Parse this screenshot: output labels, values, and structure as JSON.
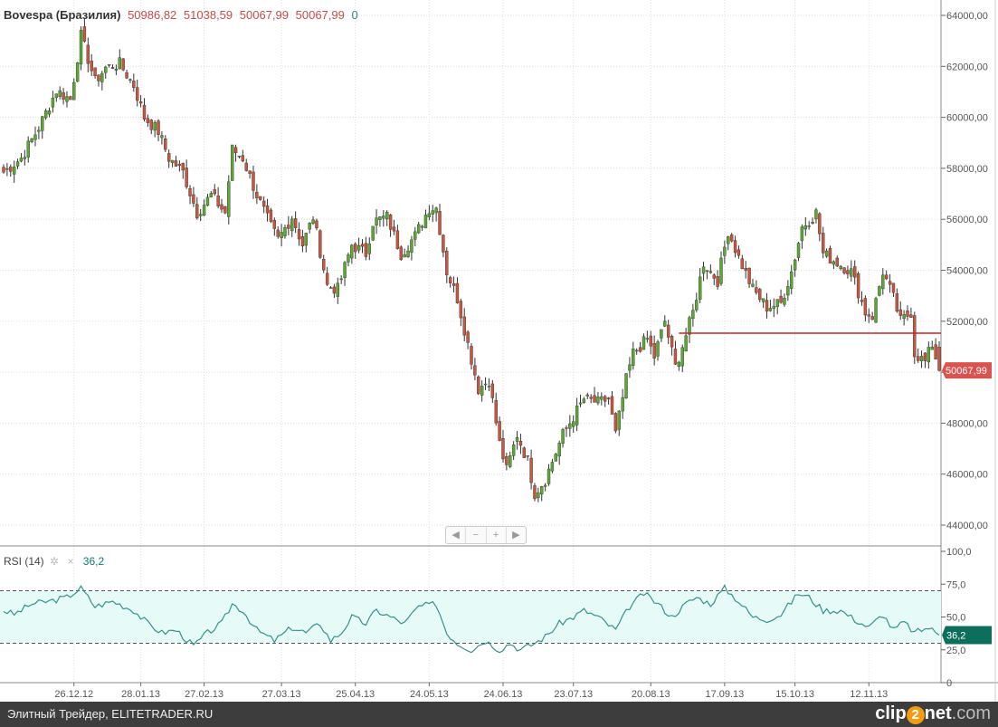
{
  "header": {
    "name": "Bovespa (Бразилия)",
    "open": "50986,82",
    "high": "51038,59",
    "low": "50067,99",
    "close": "50067,99",
    "volume": "0"
  },
  "rsi_header": {
    "label": "RSI (14)",
    "settings_icon": "gear-icon",
    "close_icon": "close-icon",
    "value": "36,2"
  },
  "nav": {
    "left": "◀",
    "minus": "−",
    "plus": "+",
    "right": "▶"
  },
  "footer": {
    "source": "Элитный Трейдер, ELITETRADER.RU",
    "logo_a": "clip",
    "logo_b": "2",
    "logo_c": "net",
    "logo_d": ".com"
  },
  "colors": {
    "up": "#5aa832",
    "down": "#c8553d",
    "rsi_line": "#3a8f8a",
    "rsi_band": "#e6fbf7",
    "last_price": "#d9534f",
    "last_rsi": "#0e6e5c",
    "level": "#cc2222"
  },
  "chart_data": {
    "type": "candlestick",
    "title": "Bovespa (Бразилия)",
    "price_axis": {
      "min": 44000,
      "max": 64000,
      "ticks": [
        "44000,00",
        "46000,00",
        "48000,00",
        "50000,00",
        "52000,00",
        "54000,00",
        "56000,00",
        "58000,00",
        "60000,00",
        "62000,00",
        "64000,00"
      ],
      "tick_values": [
        44000,
        46000,
        48000,
        50000,
        52000,
        54000,
        56000,
        58000,
        60000,
        62000,
        64000
      ]
    },
    "last_price": {
      "value": 50067.99,
      "label": "50067,99"
    },
    "horizontal_level": {
      "value": 51530,
      "from_day": 192,
      "to_day": 266
    },
    "x_ticks": [
      {
        "day": 20,
        "label": "26.12.12"
      },
      {
        "day": 39,
        "label": "28.01.13"
      },
      {
        "day": 57,
        "label": "27.02.13"
      },
      {
        "day": 79,
        "label": "27.03.13"
      },
      {
        "day": 100,
        "label": "25.04.13"
      },
      {
        "day": 121,
        "label": "24.05.13"
      },
      {
        "day": 142,
        "label": "24.06.13"
      },
      {
        "day": 162,
        "label": "23.07.13"
      },
      {
        "day": 184,
        "label": "20.08.13"
      },
      {
        "day": 205,
        "label": "17.09.13"
      },
      {
        "day": 225,
        "label": "15.10.13"
      },
      {
        "day": 246,
        "label": "12.11.13"
      }
    ],
    "total_days": 267,
    "close_keypoints": [
      [
        0,
        57850
      ],
      [
        5,
        58400
      ],
      [
        10,
        59600
      ],
      [
        15,
        61050
      ],
      [
        19,
        60700
      ],
      [
        22,
        63200
      ],
      [
        26,
        61400
      ],
      [
        29,
        61950
      ],
      [
        33,
        62100
      ],
      [
        37,
        61250
      ],
      [
        40,
        60000
      ],
      [
        44,
        59450
      ],
      [
        47,
        58400
      ],
      [
        51,
        57850
      ],
      [
        55,
        56250
      ],
      [
        59,
        56950
      ],
      [
        63,
        56250
      ],
      [
        65,
        58750
      ],
      [
        68,
        58400
      ],
      [
        72,
        56950
      ],
      [
        76,
        55700
      ],
      [
        78,
        55200
      ],
      [
        82,
        56100
      ],
      [
        85,
        55000
      ],
      [
        88,
        56100
      ],
      [
        92,
        53400
      ],
      [
        95,
        53250
      ],
      [
        99,
        55000
      ],
      [
        103,
        54650
      ],
      [
        105,
        55900
      ],
      [
        109,
        56100
      ],
      [
        113,
        54650
      ],
      [
        117,
        55350
      ],
      [
        121,
        56450
      ],
      [
        123,
        56450
      ],
      [
        126,
        53950
      ],
      [
        129,
        52900
      ],
      [
        132,
        51100
      ],
      [
        135,
        49350
      ],
      [
        138,
        49700
      ],
      [
        141,
        47200
      ],
      [
        143,
        46150
      ],
      [
        146,
        47550
      ],
      [
        149,
        46500
      ],
      [
        151,
        45250
      ],
      [
        154,
        45800
      ],
      [
        156,
        46500
      ],
      [
        159,
        47550
      ],
      [
        162,
        48250
      ],
      [
        165,
        48950
      ],
      [
        169,
        48800
      ],
      [
        172,
        48950
      ],
      [
        174,
        47550
      ],
      [
        177,
        49700
      ],
      [
        179,
        50750
      ],
      [
        183,
        51300
      ],
      [
        185,
        50600
      ],
      [
        188,
        52000
      ],
      [
        191,
        50200
      ],
      [
        194,
        51450
      ],
      [
        196,
        52350
      ],
      [
        199,
        54300
      ],
      [
        203,
        53600
      ],
      [
        206,
        55550
      ],
      [
        209,
        54500
      ],
      [
        213,
        53250
      ],
      [
        217,
        52550
      ],
      [
        221,
        52700
      ],
      [
        224,
        53950
      ],
      [
        227,
        55700
      ],
      [
        231,
        56250
      ],
      [
        233,
        54650
      ],
      [
        237,
        54300
      ],
      [
        241,
        53950
      ],
      [
        245,
        52350
      ],
      [
        247,
        52200
      ],
      [
        250,
        53950
      ],
      [
        253,
        52900
      ],
      [
        255,
        52000
      ],
      [
        258,
        52350
      ],
      [
        259,
        50750
      ],
      [
        262,
        50400
      ],
      [
        264,
        51100
      ],
      [
        266,
        50067.99
      ]
    ],
    "rsi": {
      "period": 14,
      "min": 0,
      "max": 100,
      "ticks": [
        "0",
        "25,0",
        "50,0",
        "75,0",
        "100,0"
      ],
      "tick_values": [
        0,
        25,
        50,
        75,
        100
      ],
      "levels": [
        30,
        70
      ],
      "last": {
        "value": 36.2,
        "label": "36,2"
      },
      "keypoints": [
        [
          0,
          55
        ],
        [
          3,
          52
        ],
        [
          8,
          60
        ],
        [
          13,
          62
        ],
        [
          18,
          65
        ],
        [
          22,
          72
        ],
        [
          26,
          58
        ],
        [
          31,
          62
        ],
        [
          37,
          55
        ],
        [
          41,
          45
        ],
        [
          45,
          38
        ],
        [
          49,
          40
        ],
        [
          54,
          28
        ],
        [
          58,
          38
        ],
        [
          62,
          45
        ],
        [
          65,
          60
        ],
        [
          68,
          55
        ],
        [
          72,
          40
        ],
        [
          77,
          32
        ],
        [
          82,
          42
        ],
        [
          86,
          38
        ],
        [
          90,
          45
        ],
        [
          93,
          32
        ],
        [
          96,
          38
        ],
        [
          99,
          50
        ],
        [
          103,
          45
        ],
        [
          106,
          55
        ],
        [
          110,
          50
        ],
        [
          114,
          45
        ],
        [
          118,
          58
        ],
        [
          123,
          60
        ],
        [
          126,
          38
        ],
        [
          129,
          30
        ],
        [
          133,
          25
        ],
        [
          137,
          32
        ],
        [
          141,
          25
        ],
        [
          144,
          30
        ],
        [
          147,
          25
        ],
        [
          151,
          30
        ],
        [
          154,
          35
        ],
        [
          158,
          45
        ],
        [
          162,
          50
        ],
        [
          165,
          55
        ],
        [
          169,
          50
        ],
        [
          174,
          40
        ],
        [
          178,
          58
        ],
        [
          182,
          68
        ],
        [
          186,
          60
        ],
        [
          190,
          50
        ],
        [
          194,
          60
        ],
        [
          197,
          65
        ],
        [
          201,
          60
        ],
        [
          205,
          72
        ],
        [
          209,
          62
        ],
        [
          213,
          50
        ],
        [
          217,
          48
        ],
        [
          221,
          52
        ],
        [
          226,
          68
        ],
        [
          229,
          65
        ],
        [
          233,
          55
        ],
        [
          238,
          55
        ],
        [
          242,
          48
        ],
        [
          246,
          42
        ],
        [
          250,
          52
        ],
        [
          253,
          40
        ],
        [
          256,
          46
        ],
        [
          259,
          38
        ],
        [
          263,
          42
        ],
        [
          266,
          36.2
        ]
      ]
    }
  }
}
